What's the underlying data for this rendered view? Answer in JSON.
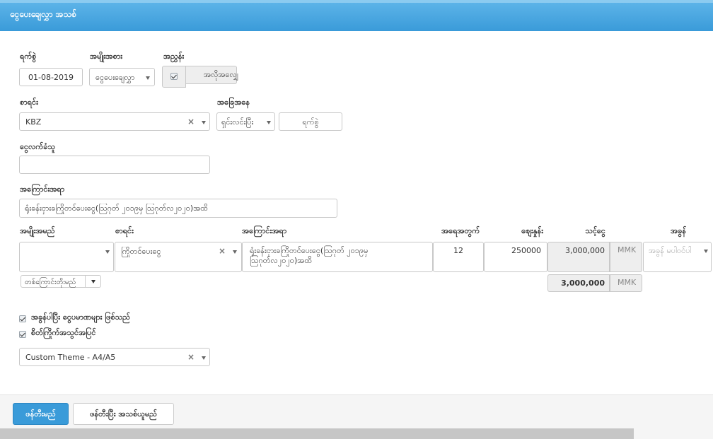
{
  "header": {
    "title": "ငွေပေးချေလွှာ အသစ်"
  },
  "form": {
    "date": {
      "label": "ရက်စွဲ",
      "value": "01-08-2019"
    },
    "type": {
      "label": "အမျိုးအစား",
      "value": "ငွေပေးချေလွှာ"
    },
    "ref_no": {
      "label": "အညွှန်း",
      "value": "အလိုအလျှေ"
    },
    "account": {
      "label": "စာရင်း",
      "value": "KBZ"
    },
    "status": {
      "label": "အခြေအနေ",
      "value": "ရှင်းလင်းပြီး",
      "date_placeholder": "ရက်စွဲ"
    },
    "payee": {
      "label": "ငွေလက်ခံသူ",
      "value": ""
    },
    "description": {
      "label": "အကြောင်းအရာ",
      "value": "ရုံးခန်းငှားခကြိုတင်ပေးငွေ(ဩဂုတ် ၂၀၁၉မှ ဩဂုတ်လ၂၀၂၀)အထိ"
    }
  },
  "lines": {
    "headers": {
      "kind": "အမျိုးအမည်",
      "account": "စာရင်း",
      "description": "အကြောင်းအရာ",
      "qty": "အရေအတွက်",
      "price": "စျေးနှုန်း",
      "amount": "သင့်ငွေ",
      "tax": "အခွန်"
    },
    "row": {
      "kind": "",
      "account": "ကြိုတင်ပေးငွေ",
      "description": "ရုံးခန်းငှားခကြိုတင်ပေးငွေ(ဩဂုတ် ၂၀၁၉မှ ဩဂုတ်လ၂၀၂၀)အထိ",
      "qty": "12",
      "price": "250000",
      "amount": "3,000,000",
      "currency": "MMK",
      "tax_placeholder": "အခွန် မပါဝင်ပါ"
    },
    "add_line": "တစ်ကြောင်းတိုးမည်",
    "total": "3,000,000",
    "total_currency": "MMK"
  },
  "options": {
    "tax_inclusive": "အခွန်ပါပြီး ငွေပမာဏများ ဖြစ်သည်",
    "custom_print": "စိတ်ကြိုက်အသွင်အပြင်"
  },
  "theme": {
    "value": "Custom Theme - A4/A5"
  },
  "footer": {
    "create": "ဖန်တီးမည်",
    "create_new": "ဖန်တီးပြီး အသစ်ယူမည်"
  }
}
